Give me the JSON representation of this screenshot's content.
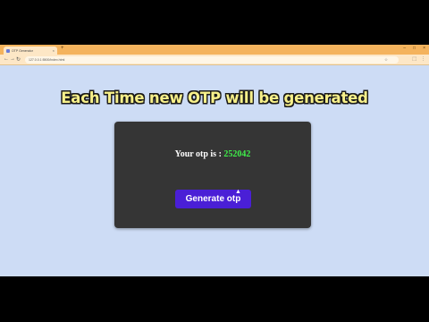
{
  "browser": {
    "tab_title": "OTP Generator",
    "tab_close": "×",
    "new_tab": "+",
    "window_controls": [
      "–",
      "□",
      "×"
    ],
    "nav": {
      "back": "←",
      "forward": "→",
      "reload": "↻"
    },
    "url": "127.0.0.1:5500/index.html",
    "omnibox_icons": [
      "☆"
    ],
    "toolbar_icons": [
      "⬚",
      "⋮"
    ]
  },
  "page": {
    "headline": "Each Time new OTP will be generated",
    "otp_label": "Your otp is : ",
    "otp_value": "252042",
    "generate_button": "Generate otp"
  },
  "colors": {
    "page_background": "#cddcf5",
    "card_background": "#353535",
    "otp_value": "#3ff04a",
    "button": "#4a1fd6",
    "headline": "#f7f08a"
  }
}
